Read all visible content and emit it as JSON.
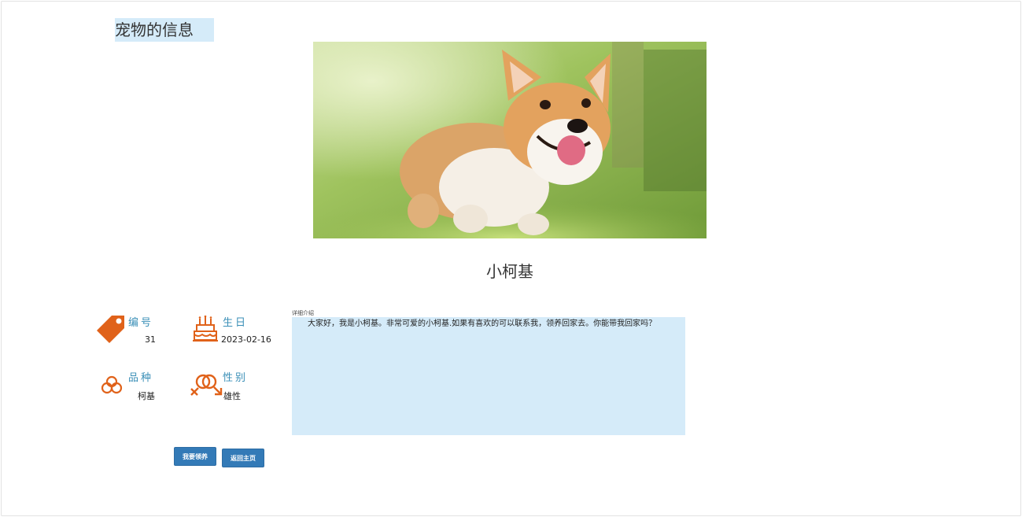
{
  "page": {
    "title": "宠物的信息"
  },
  "pet": {
    "name": "小柯基",
    "photo_icon": "corgi-photo"
  },
  "info": {
    "id_label": "编号",
    "id_value": "31",
    "birthday_label": "生日",
    "birthday_value": "2023-02-16",
    "breed_label": "品种",
    "breed_value": "柯基",
    "gender_label": "性别",
    "gender_value": "雄性"
  },
  "description": {
    "label": "详细介绍",
    "text": "大家好，我是小柯基。非常可爱的小柯基.如果有喜欢的可以联系我，领养回家去。你能带我回家吗？"
  },
  "actions": {
    "adopt_label": "我要领养",
    "home_label": "返回主页"
  },
  "colors": {
    "icon": "#e0621a",
    "label": "#3a8fb7",
    "highlight": "#d5ebf9",
    "button": "#337ab7"
  },
  "icons": [
    "tag-icon",
    "birthday-cake-icon",
    "breed-circles-icon",
    "gender-icon"
  ]
}
